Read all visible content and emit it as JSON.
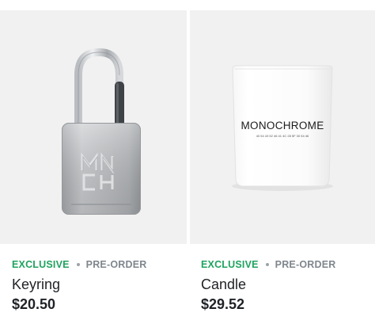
{
  "products": [
    {
      "image_alt": "padlock keyring",
      "badge_primary": "EXCLUSIVE",
      "badge_secondary": "PRE-ORDER",
      "name": "Keyring",
      "price": "$20.50"
    },
    {
      "image_alt": "white candle",
      "badge_primary": "EXCLUSIVE",
      "badge_secondary": "PRE-ORDER",
      "name": "Candle",
      "price": "$29.52",
      "label_brand": "MONOCHROME",
      "label_code": "40 54 43 52 46 41 4C 28 5F 30 54 46"
    }
  ],
  "colors": {
    "exclusive": "#1fa35f",
    "preorder": "#7f868d",
    "image_bg": "#f1f1f1",
    "text": "#1f2226"
  }
}
